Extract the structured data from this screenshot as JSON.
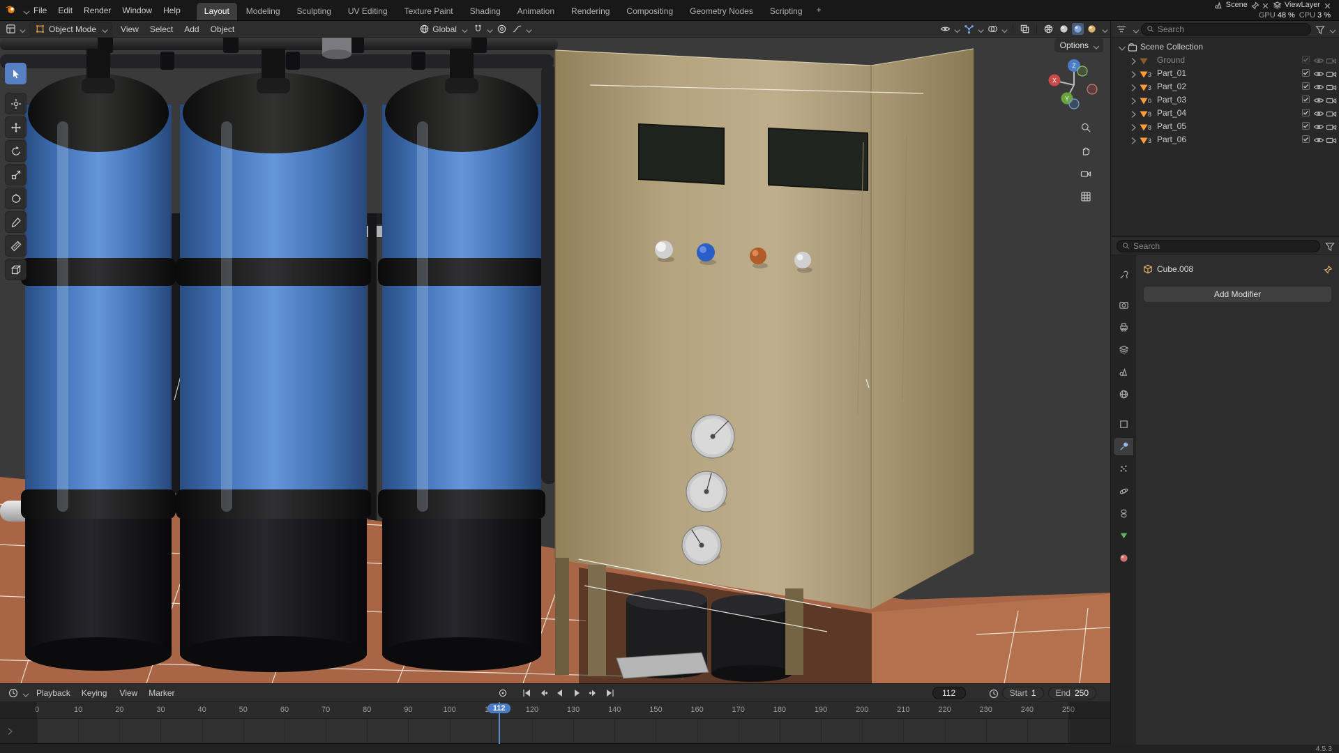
{
  "colors": {
    "accent_blue": "#4772b3",
    "selection_blue": "#5680c2",
    "tank_blue": "#4a7cc8",
    "cabinet_tan": "#b3a27c",
    "floor_terracotta": "#a96646",
    "mesh_icon_orange": "#ff9d3c"
  },
  "topbar": {
    "menus": [
      "File",
      "Edit",
      "Render",
      "Window",
      "Help"
    ],
    "workspaces": [
      "Layout",
      "Modeling",
      "Sculpting",
      "UV Editing",
      "Texture Paint",
      "Shading",
      "Animation",
      "Rendering",
      "Compositing",
      "Geometry Nodes",
      "Scripting"
    ],
    "active_workspace": "Layout",
    "add_workspace_label": "+",
    "scene_label": "Scene",
    "viewlayer_label": "ViewLayer",
    "stats": {
      "gpu_label": "GPU",
      "gpu_value": "48 %",
      "cpu_label": "CPU",
      "cpu_value": "3 %"
    }
  },
  "viewport": {
    "header": {
      "mode": "Object Mode",
      "menus": [
        "View",
        "Select",
        "Add",
        "Object"
      ],
      "orientation": "Global",
      "options_label": "Options"
    },
    "gizmo_axes": {
      "x": "X",
      "y": "Y",
      "z": "Z"
    }
  },
  "toolbar_tools": [
    "select-box",
    "cursor",
    "move",
    "rotate",
    "scale",
    "transform",
    "annotate",
    "measure",
    "add-cube"
  ],
  "outliner": {
    "search_placeholder": "Search",
    "root_label": "Scene Collection",
    "items": [
      {
        "name": "Ground",
        "count": "",
        "muted": true
      },
      {
        "name": "Part_01",
        "count": "3",
        "muted": false
      },
      {
        "name": "Part_02",
        "count": "3",
        "muted": false
      },
      {
        "name": "Part_03",
        "count": "0",
        "muted": false
      },
      {
        "name": "Part_04",
        "count": "8",
        "muted": false
      },
      {
        "name": "Part_05",
        "count": "8",
        "muted": false
      },
      {
        "name": "Part_06",
        "count": "3",
        "muted": false
      }
    ]
  },
  "properties": {
    "search_placeholder": "Search",
    "object_name": "Cube.008",
    "add_modifier_label": "Add Modifier",
    "tabs": [
      "tool",
      "render",
      "output",
      "view-layer",
      "scene",
      "world",
      "object",
      "modifiers",
      "particles",
      "physics",
      "constraints",
      "data",
      "material"
    ],
    "active_tab": "modifiers"
  },
  "timeline": {
    "popovers": [
      "Playback",
      "Keying"
    ],
    "menus": [
      "View",
      "Marker"
    ],
    "current_frame": "112",
    "current": 112,
    "start_label": "Start",
    "start_value": "1",
    "end_label": "End",
    "end_value": "250",
    "frame_min": 0,
    "frame_max": 250,
    "tick_step": 10
  },
  "statusbar": {
    "version": "4.5.3"
  }
}
